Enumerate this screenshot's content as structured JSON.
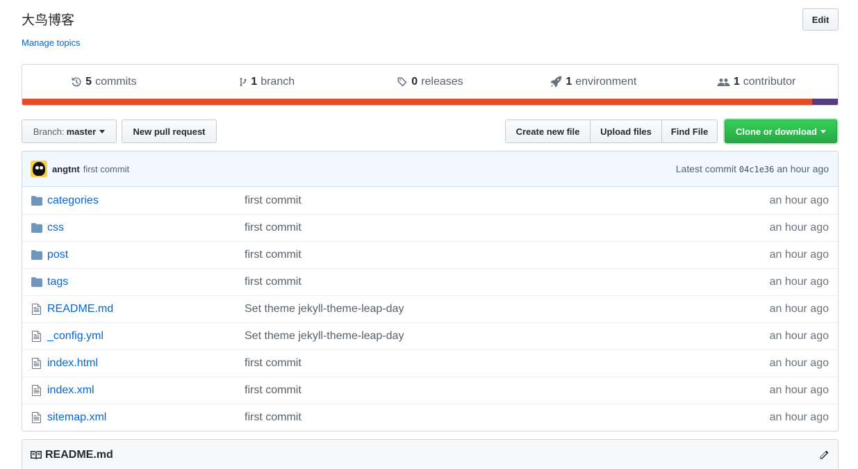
{
  "repo": {
    "description": "大鸟博客",
    "manage_topics": "Manage topics",
    "edit_label": "Edit"
  },
  "summary": {
    "commits": {
      "count": "5",
      "label": "commits"
    },
    "branches": {
      "count": "1",
      "label": "branch"
    },
    "releases": {
      "count": "0",
      "label": "releases"
    },
    "environments": {
      "count": "1",
      "label": "environment"
    },
    "contributors": {
      "count": "1",
      "label": "contributor"
    }
  },
  "language_bar": [
    {
      "color": "#e34c26",
      "fraction": 0.9685
    },
    {
      "color": "#563d7c",
      "fraction": 0.0315
    }
  ],
  "toolbar": {
    "branch_prefix": "Branch:",
    "branch_name": "master",
    "new_pull_request": "New pull request",
    "create_new_file": "Create new file",
    "upload_files": "Upload files",
    "find_file": "Find File",
    "clone_or_download": "Clone or download"
  },
  "latest_commit": {
    "author": "angtnt",
    "message": "first commit",
    "label": "Latest commit",
    "sha": "04c1e36",
    "time": "an hour ago"
  },
  "files": [
    {
      "type": "folder",
      "name": "categories",
      "message": "first commit",
      "age": "an hour ago"
    },
    {
      "type": "folder",
      "name": "css",
      "message": "first commit",
      "age": "an hour ago"
    },
    {
      "type": "folder",
      "name": "post",
      "message": "first commit",
      "age": "an hour ago"
    },
    {
      "type": "folder",
      "name": "tags",
      "message": "first commit",
      "age": "an hour ago"
    },
    {
      "type": "file",
      "name": "README.md",
      "message": "Set theme jekyll-theme-leap-day",
      "age": "an hour ago"
    },
    {
      "type": "file",
      "name": "_config.yml",
      "message": "Set theme jekyll-theme-leap-day",
      "age": "an hour ago"
    },
    {
      "type": "file",
      "name": "index.html",
      "message": "first commit",
      "age": "an hour ago"
    },
    {
      "type": "file",
      "name": "index.xml",
      "message": "first commit",
      "age": "an hour ago"
    },
    {
      "type": "file",
      "name": "sitemap.xml",
      "message": "first commit",
      "age": "an hour ago"
    }
  ],
  "readme": {
    "title": "README.md"
  },
  "icons": {
    "commits": "history-icon",
    "branch": "branch-icon",
    "releases": "tag-icon",
    "environment": "rocket-icon",
    "contributors": "people-icon",
    "folder": "folder-icon",
    "file": "file-icon",
    "readme": "book-icon",
    "edit": "pencil-icon"
  },
  "colors": {
    "link": "#0366d6",
    "clone_button": "#28a745"
  }
}
